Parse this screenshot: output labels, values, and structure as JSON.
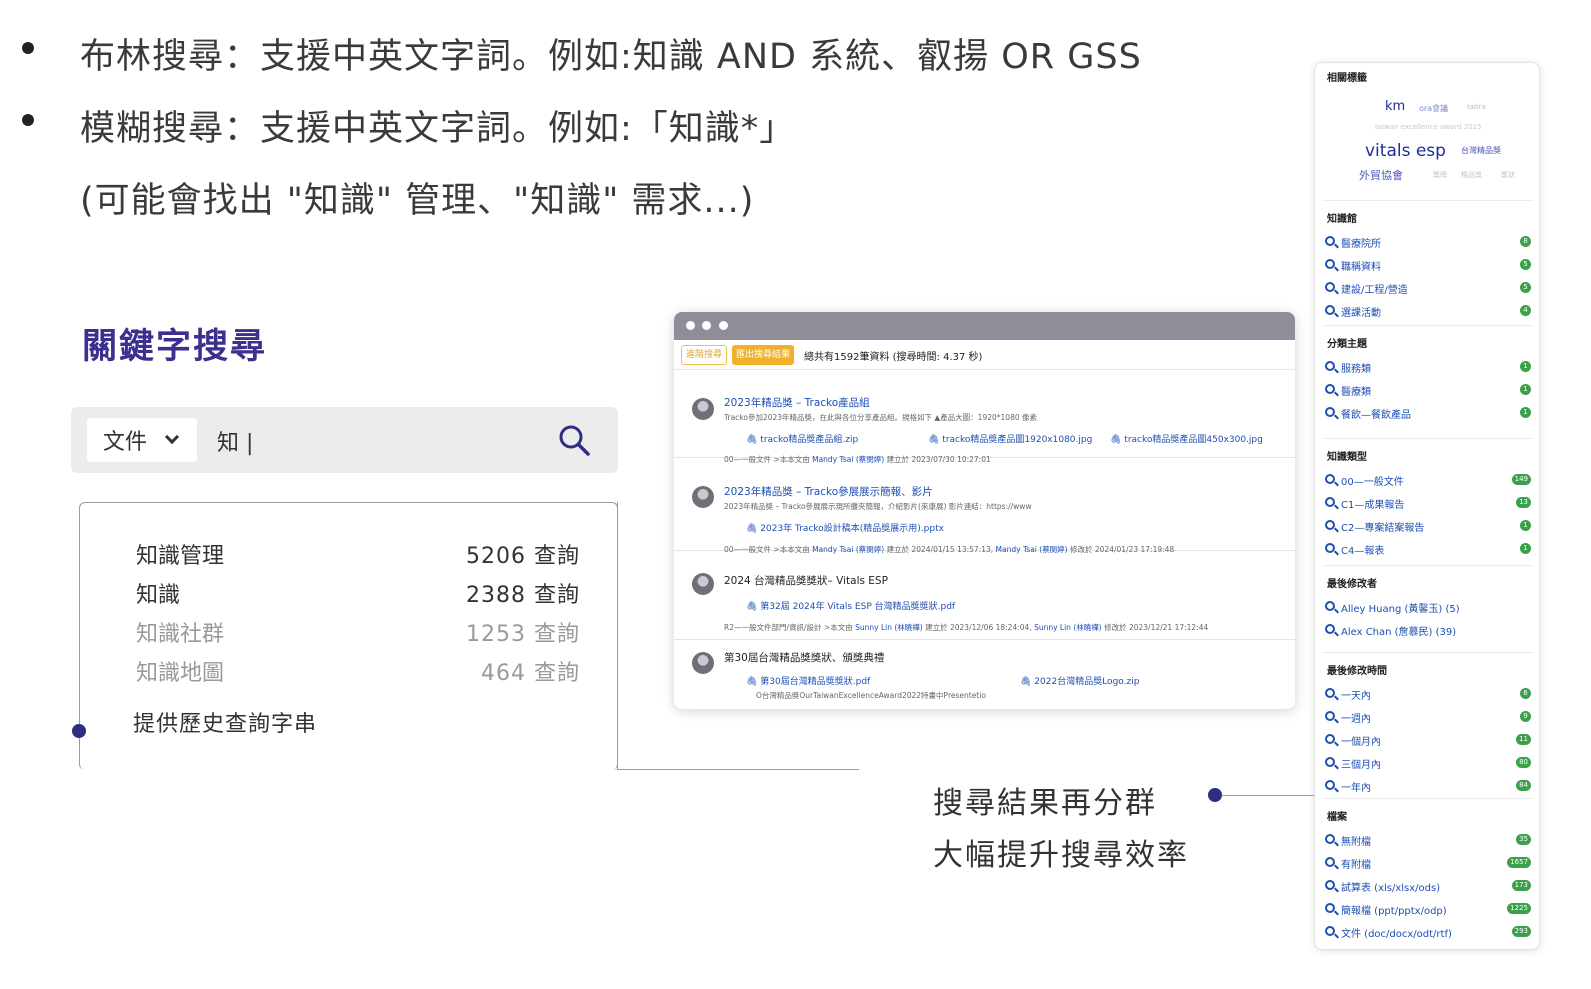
{
  "bullets": {
    "line1": "布林搜尋：支援中英文字詞。例如:知識 AND 系統、叡揚 OR GSS",
    "line2": "模糊搜尋：支援中英文字詞。例如:「知識*」",
    "line3": "(可能會找出 \"知識\" 管理、\"知識\" 需求...)"
  },
  "keyword_section": {
    "title": "關鍵字搜尋",
    "scope": "文件",
    "query": "知 |",
    "suggestions": [
      {
        "term": "知識管理",
        "count": "5206 查詢",
        "color": "#333333"
      },
      {
        "term": "知識",
        "count": "2388 查詢",
        "color": "#333333"
      },
      {
        "term": "知識社群",
        "count": "1253 查詢",
        "color": "#9a9a9a"
      },
      {
        "term": "知識地圖",
        "count": "464 查詢",
        "color": "#9a9a9a"
      }
    ],
    "history_note": "提供歷史查詢字串"
  },
  "browser": {
    "advanced_button": "進階搜尋",
    "export_button": "匯出搜尋結果",
    "total": "總共有1592筆資料 (搜尋時間: 4.37 秒)",
    "results": [
      {
        "title": "2023年精品獎 – Tracko產品組",
        "desc": "Tracko參加2023年精品獎，在此與各位分享產品組。規格如下 ▲產品大圖：1920*1080 像素",
        "files": [
          "tracko精品獎產品組.zip",
          "tracko精品獎產品圖1920x1080.jpg",
          "tracko精品獎產品圖450x300.jpg"
        ],
        "meta_prefix": "00—一般文件 >本本文由",
        "meta_user": "Mandy Tsai (蔡閔婷)",
        "meta_suffix": "建立於 2023/07/30 10:27:01"
      },
      {
        "title": "2023年精品獎 – Tracko參展展示簡報、影片",
        "desc": "2023年精品獎 – Tracko參展展示現所攤夾簡報，介紹影片(來康展) 影片連結：https://www",
        "files": [
          "2023年 Tracko設計稿本(精品獎展示用).pptx"
        ],
        "meta_prefix": "00—一般文件 >本本文由",
        "meta_user": "Mandy Tsai (蔡閔婷)",
        "meta_suffix": "建立於 2024/01/15 13:57:13,",
        "meta_user2": "Mandy Tsai (蔡閔婷)",
        "meta_suffix2": "修改於 2024/01/23 17:19:48"
      },
      {
        "title": "2024 台灣精品獎獎狀– Vitals ESP",
        "files": [
          "第32屆 2024年 Vitals ESP 台灣精品獎獎狀.pdf"
        ],
        "meta_prefix": "R2—一般文件部門/資訊/設計 >本文由",
        "meta_user": "Sunny Lin (林曉樺)",
        "meta_suffix": "建立於 2023/12/06 18:24:04,",
        "meta_user2": "Sunny Lin (林曉樺)",
        "meta_suffix2": "修改於 2023/12/21 17:12:44"
      },
      {
        "title": "第30屆台灣精品獎獎狀、頒獎典禮",
        "files": [
          "第30屆台灣精品獎獎狀.pdf",
          "2022台灣精品獎Logo.zip"
        ],
        "desc2": "O台灣精品獎OurTaiwanExcellenceAward2022特畫中Presentetio"
      }
    ]
  },
  "panel": {
    "related_tags_heading": "相關標籤",
    "tags": [
      {
        "text": "km",
        "color": "#1d2c9e"
      },
      {
        "text": "ora會議",
        "color": "#7f86c4"
      },
      {
        "text": "taitra",
        "color": "#b9b9c9"
      },
      {
        "text": "taiwan excellence award 2015",
        "color": "#c8c8d0"
      },
      {
        "text": "vitals esp",
        "color": "#1d2c9e"
      },
      {
        "text": "台灣精品獎",
        "color": "#4d57b8"
      },
      {
        "text": "外貿協會",
        "color": "#4d57b8"
      },
      {
        "text": "獎牌",
        "color": "#c2c2cc"
      },
      {
        "text": "精品獎",
        "color": "#c2c2cc"
      },
      {
        "text": "獎狀",
        "color": "#c2c2cc"
      }
    ],
    "groups": [
      {
        "heading": "知識館",
        "items": [
          {
            "label": "醫療院所",
            "count": "8"
          },
          {
            "label": "職稱資料",
            "count": "5"
          },
          {
            "label": "建設/工程/營造",
            "count": "5"
          },
          {
            "label": "選課活動",
            "count": "4"
          }
        ]
      },
      {
        "heading": "分類主題",
        "items": [
          {
            "label": "服務類",
            "count": "1"
          },
          {
            "label": "醫療類",
            "count": "1"
          },
          {
            "label": "餐飲—餐飲產品",
            "count": "1"
          }
        ]
      },
      {
        "heading": "知識類型",
        "items": [
          {
            "label": "00—一般文件",
            "count": "149"
          },
          {
            "label": "C1—成果報告",
            "count": "13"
          },
          {
            "label": "C2—專案結案報告",
            "count": "1"
          },
          {
            "label": "C4—報表",
            "count": "1"
          }
        ]
      },
      {
        "heading": "最後修改者",
        "items": [
          {
            "label": "Alley Huang (黃馨玉) (5)",
            "count": ""
          },
          {
            "label": "Alex Chan (詹慕民) (39)",
            "count": ""
          }
        ]
      },
      {
        "heading": "最後修改時間",
        "items": [
          {
            "label": "一天內",
            "count": "6"
          },
          {
            "label": "一週內",
            "count": "9"
          },
          {
            "label": "一個月內",
            "count": "11"
          },
          {
            "label": "三個月內",
            "count": "80"
          },
          {
            "label": "一年內",
            "count": "84"
          }
        ]
      },
      {
        "heading": "檔案",
        "items": [
          {
            "label": "無附檔",
            "count": "35"
          },
          {
            "label": "有附檔",
            "count": "1657"
          },
          {
            "label": "試算表 (xls/xlsx/ods)",
            "count": "173"
          },
          {
            "label": "簡報檔 (ppt/pptx/odp)",
            "count": "1225"
          },
          {
            "label": "文件 (doc/docx/odt/rtf)",
            "count": "293"
          }
        ]
      }
    ]
  },
  "caption": {
    "line1": "搜尋結果再分群",
    "line2": "大幅提升搜尋效率"
  },
  "colors": {
    "accent_purple": "#3b2f8f",
    "link_blue": "#1d4fb3",
    "badge_green": "#3aa04a",
    "button_yellow": "#efb12c"
  }
}
